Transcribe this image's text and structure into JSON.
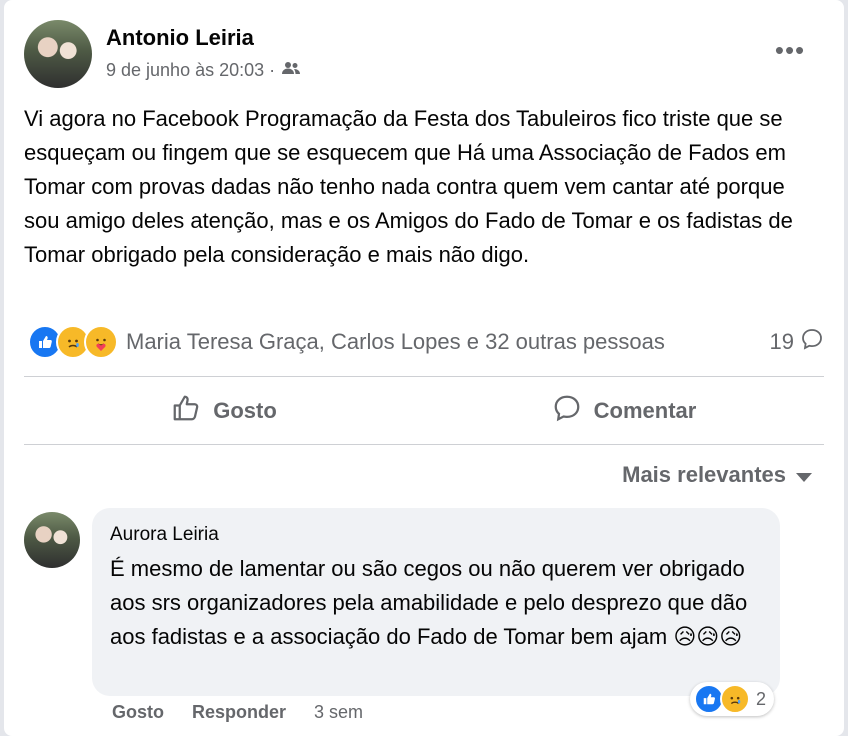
{
  "post": {
    "author": "Antonio Leiria",
    "timestamp": "9 de junho às 20:03 ·",
    "audience_icon": "friends-icon",
    "text": "Vi agora no Facebook Programação da Festa dos Tabuleiros fico triste que se esqueçam ou fingem que se esquecem que Há uma Associação de Fados em  Tomar com provas dadas não tenho nada contra quem vem cantar até porque sou amigo deles atenção, mas e os Amigos do Fado de Tomar e os fadistas de Tomar obrigado pela consideração e mais não digo.",
    "more_label": "•••"
  },
  "reactions": {
    "icons": [
      "like-icon",
      "sad-icon",
      "care-icon"
    ],
    "names": "Maria Teresa Graça, Carlos Lopes e 32 outras pessoas",
    "comment_count": "19"
  },
  "actions": {
    "like_label": "Gosto",
    "comment_label": "Comentar"
  },
  "sort_label": "Mais relevantes",
  "comment": {
    "author": "Aurora Leiria",
    "text": "É mesmo de lamentar ou são cegos ou não querem ver obrigado aos srs organizadores pela amabilidade e pelo desprezo que dão aos fadistas e a associação do Fado de Tomar bem ajam 😥😥😥",
    "reaction_count": "2",
    "like_label": "Gosto",
    "reply_label": "Responder",
    "time": "3 sem"
  },
  "colors": {
    "like_blue": "#1877f2",
    "emoji_yellow": "#f7b928",
    "secondary_text": "#65676b"
  }
}
